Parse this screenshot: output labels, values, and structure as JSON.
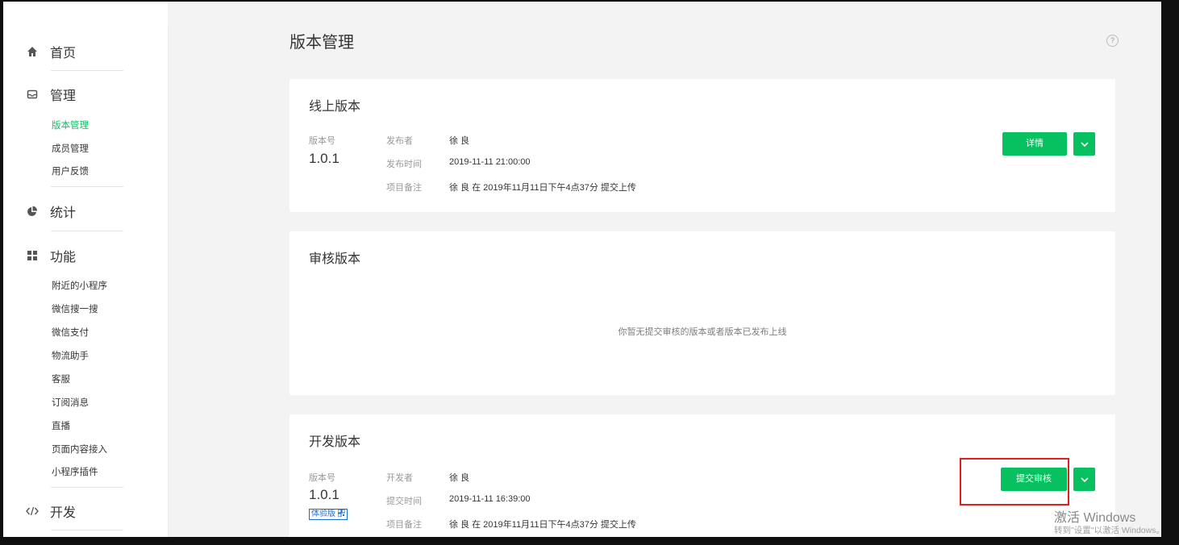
{
  "sidebar": {
    "sections": [
      {
        "label": "首页",
        "icon": "home-icon"
      },
      {
        "label": "管理",
        "icon": "inbox-icon"
      },
      {
        "label": "统计",
        "icon": "pie-chart-icon"
      },
      {
        "label": "功能",
        "icon": "grid-icon"
      },
      {
        "label": "开发",
        "icon": "code-icon"
      }
    ],
    "manage_items": [
      "版本管理",
      "成员管理",
      "用户反馈"
    ],
    "feature_items": [
      "附近的小程序",
      "微信搜一搜",
      "微信支付",
      "物流助手",
      "客服",
      "订阅消息",
      "直播",
      "页面内容接入",
      "小程序插件"
    ]
  },
  "page": {
    "title": "版本管理",
    "help_icon": "?"
  },
  "online": {
    "title": "线上版本",
    "version_label": "版本号",
    "version": "1.0.1",
    "publisher_label": "发布者",
    "publisher": "徐 良",
    "time_label": "发布时间",
    "time": "2019-11-11 21:00:00",
    "note_label": "项目备注",
    "note": "徐 良 在 2019年11月11日下午4点37分 提交上传",
    "detail_button": "详情"
  },
  "review": {
    "title": "审核版本",
    "empty_text": "你暂无提交审核的版本或者版本已发布上线"
  },
  "dev": {
    "title": "开发版本",
    "version_label": "版本号",
    "version": "1.0.1",
    "tag": "体验版",
    "developer_label": "开发者",
    "developer": "徐 良",
    "time_label": "提交时间",
    "time": "2019-11-11 16:39:00",
    "note_label": "项目备注",
    "note": "徐 良 在 2019年11月11日下午4点37分 提交上传",
    "submit_button": "提交审核"
  },
  "watermark": {
    "line1": "激活 Windows",
    "line2": "转到\"设置\"以激活 Windows。"
  },
  "colors": {
    "accent": "#07c160",
    "highlight": "#e02020"
  }
}
